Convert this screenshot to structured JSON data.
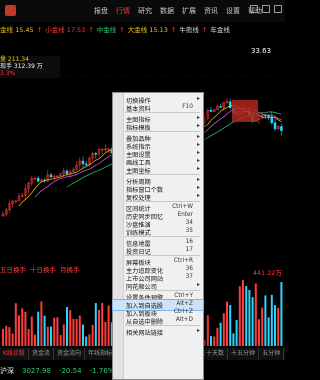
{
  "menu": {
    "items": [
      "报盘",
      "行情",
      "研究",
      "数据",
      "扩展",
      "资讯",
      "设置",
      "帮助"
    ],
    "active_index": 1
  },
  "legend": [
    {
      "text": "金线 15.45",
      "color": "#f1c40f"
    },
    {
      "text": "↑",
      "color": "#ff3b3b"
    },
    {
      "text": "小金线 17.53",
      "color": "#ff3b3b"
    },
    {
      "text": "↑",
      "color": "#ff3b3b"
    },
    {
      "text": "中金线",
      "color": "#2ecc71"
    },
    {
      "text": "↑",
      "color": "#ff3b3b"
    },
    {
      "text": "大金线 15.13",
      "color": "#f1c40f"
    },
    {
      "text": "↑",
      "color": "#ff3b3b"
    },
    {
      "text": "牛熊线",
      "color": "#ddd"
    },
    {
      "text": "↑",
      "color": "#ff3b3b"
    },
    {
      "text": "年金线",
      "color": "#ddd"
    }
  ],
  "price_high": "33.63",
  "info": {
    "line1": "量 211.34",
    "line2": "现手 312.39 万",
    "line3": "3.3%"
  },
  "vol_legend": [
    {
      "text": "五日换手",
      "color": "#ff3b3b"
    },
    {
      "text": "十日换手",
      "color": "#ff3b3b"
    },
    {
      "text": "月换手",
      "color": "#ff3b3b"
    }
  ],
  "vol_value": "441.22万",
  "tabs": [
    "K线诊股",
    "资金流",
    "资金流向",
    "年线指标",
    "季线指标",
    "月线",
    "财务指标",
    "三十天数",
    "十五分钟",
    "五分钟",
    "三十数"
  ],
  "tabs_active": 0,
  "status": [
    {
      "text": "沪深",
      "color": "#fff"
    },
    {
      "text": "3027.98",
      "color": "#2ecc71"
    },
    {
      "text": "-20.54",
      "color": "#2ecc71"
    },
    {
      "text": "-1.76%",
      "color": "#2ecc71"
    },
    {
      "text": "394.5亿",
      "color": "#fff"
    },
    {
      "text": "447.3亿",
      "color": "#fff"
    }
  ],
  "context_menu": {
    "items": [
      {
        "label": "切换操作",
        "arrow": true
      },
      {
        "label": "基本资料",
        "shortcut": "F10"
      },
      {
        "sep": true
      },
      {
        "label": "主图指标",
        "arrow": true
      },
      {
        "label": "指标模板",
        "arrow": true
      },
      {
        "sep": true
      },
      {
        "label": "叠加品种",
        "arrow": true
      },
      {
        "label": "系统指示",
        "arrow": true
      },
      {
        "label": "主图设置",
        "arrow": true
      },
      {
        "label": "画线工具",
        "arrow": true
      },
      {
        "label": "主图坐标",
        "arrow": true
      },
      {
        "sep": true
      },
      {
        "label": "分析周期",
        "arrow": true
      },
      {
        "label": "指标窗口个数",
        "arrow": true
      },
      {
        "label": "复权处理",
        "arrow": true
      },
      {
        "sep": true
      },
      {
        "label": "区间统计",
        "shortcut": "Ctrl+W"
      },
      {
        "label": "历史同步回忆",
        "shortcut": "Enter"
      },
      {
        "label": "沙盘推演",
        "shortcut": "34"
      },
      {
        "label": "训练模式",
        "shortcut": "35"
      },
      {
        "sep": true
      },
      {
        "label": "信息地雷",
        "shortcut": "16"
      },
      {
        "label": "投资日记",
        "shortcut": "17"
      },
      {
        "sep": true
      },
      {
        "label": "屏幕板块",
        "shortcut": "Ctrl+R"
      },
      {
        "label": "主力追踪变化",
        "shortcut": "36"
      },
      {
        "label": "上市公司网站",
        "shortcut": "37"
      },
      {
        "label": "同花顺公司",
        "arrow": true
      },
      {
        "sep": true
      },
      {
        "label": "设置条件预警",
        "shortcut": "Ctrl+Y"
      },
      {
        "label": "加入到自选股",
        "shortcut": "Alt+Z",
        "highlight": true
      },
      {
        "label": "加入到板块",
        "shortcut": "Ctrl+Z"
      },
      {
        "label": "从自选中删除",
        "shortcut": "Alt+D"
      },
      {
        "sep": true
      },
      {
        "label": "相关网站链接",
        "arrow": true
      }
    ]
  },
  "colors": {
    "up": "#ff3b3b",
    "down": "#2ecc71",
    "accent": "#f1c40f"
  }
}
